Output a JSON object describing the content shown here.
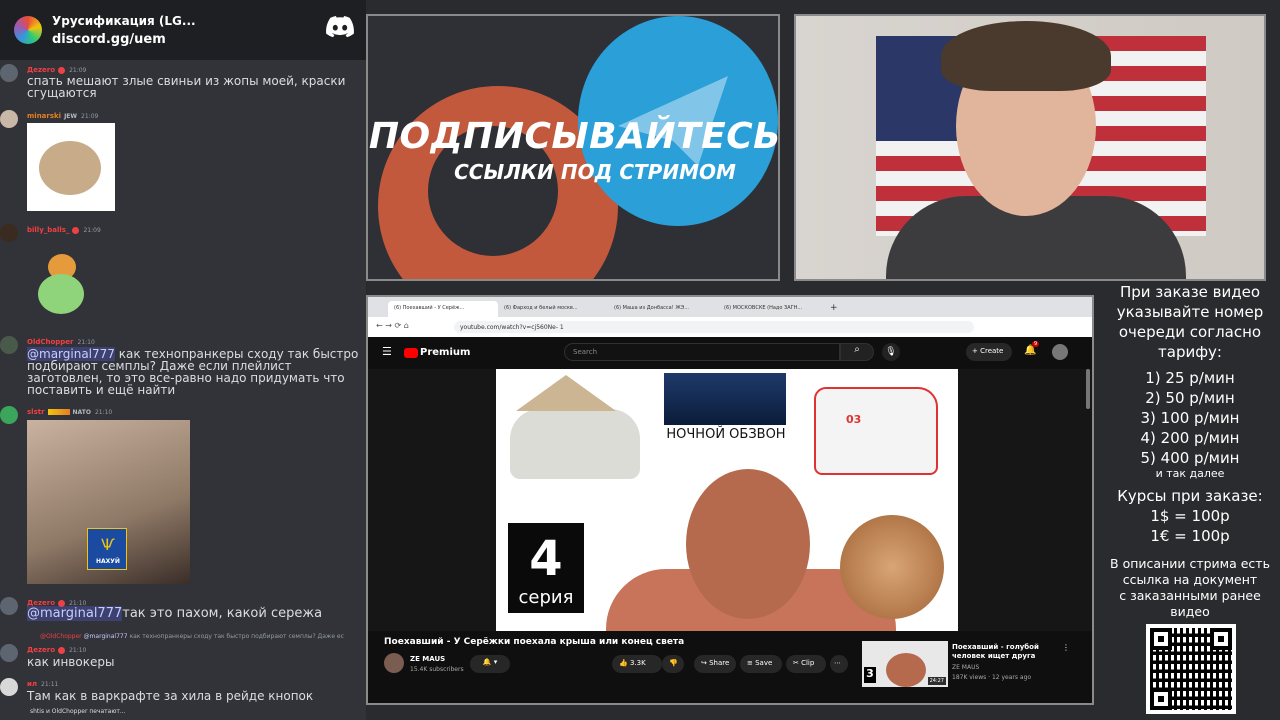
{
  "discord": {
    "server_name": "Урусификация (LG...",
    "invite": "discord.gg/uem",
    "messages": [
      {
        "user": "Дezero",
        "time": "21:09",
        "color": "#f23f43",
        "text": "спать мешают злые свиньи из жопы моей, краски сгущаются"
      },
      {
        "user": "minarski",
        "time": "21:09",
        "color": "#e67e22",
        "tag": "JEW",
        "text": ""
      },
      {
        "user": "billy_balls_",
        "time": "21:09",
        "color": "#f23f43",
        "text": ""
      },
      {
        "user": "OldChopper",
        "time": "21:10",
        "color": "#f23f43",
        "mention": "@marginal777",
        "text": " как технопранкеры сходу так быстро подбирают семплы? Даже если плейлист заготовлен, то это все-равно надо придумать что поставить и ещё найти"
      },
      {
        "user": "slstr",
        "time": "21:10",
        "color": "#f23f43",
        "tag": "NATO",
        "text": "",
        "stamp": "НАХУЙ"
      },
      {
        "user": "Дezero",
        "time": "21:10",
        "color": "#f23f43",
        "mention": "@marginal777",
        "text": "так это пахом, какой сережа"
      },
      {
        "reply_user": "@OldChopper",
        "reply_mention": "@marginal777",
        "reply_text": "как технопранкеры сходу так быстро подбирают семплы? Даже ес"
      },
      {
        "user": "Дezero",
        "time": "21:10",
        "color": "#f23f43",
        "text": "как инвокеры"
      },
      {
        "user": "ил",
        "time": "21:11",
        "color": "#f23f43",
        "text": "Там как в варкрафте за хила в рейде кнопок"
      }
    ],
    "typing_text": "shtis и OldChopper печатают..."
  },
  "promo": {
    "title": "ПОДПИСЫВАЙТЕСЬ",
    "subtitle": "ССЫЛКИ ПОД СТРИМОМ"
  },
  "browser": {
    "tabs": [
      "(6) Поехавший - У Серёж...",
      "(6) Фарход и белый москв...",
      "(6) Маша из Донбасса! ЖЭ...",
      "(6) МОСКОВСКЕ (Надо ЗАГН..."
    ],
    "url": "youtube.com/watch?v=cj560Ne- 1",
    "youtube": {
      "logo": "Premium",
      "search_placeholder": "Search",
      "create_label": "Create",
      "notif_count": "9",
      "video_title": "Поехавший - У Серёжки поехала крыша или конец света",
      "channel": "ZE MAUS",
      "subscribers": "15.4K subscribers",
      "likes": "3.3K",
      "share": "Share",
      "save": "Save",
      "clip": "Clip",
      "thumb_label": "НОЧНОЙ ОБЗВОН",
      "thumb_episode_num": "4",
      "thumb_episode_word": "серия",
      "thumb_ambulance": "03",
      "recommended": {
        "title": "Поехавший - голубой человек ищет друга",
        "channel": "ZE MAUS",
        "meta": "187K views · 12 years ago",
        "duration": "24:27",
        "thumb_num": "3"
      }
    }
  },
  "info": {
    "heading": [
      "При заказе видео",
      "указывайте номер",
      "очереди согласно",
      "тарифу:"
    ],
    "tariffs": [
      "1) 25 р/мин",
      "2) 50 р/мин",
      "3) 100 р/мин",
      "4) 200 р/мин",
      "5) 400 р/мин"
    ],
    "etc": "и так далее",
    "rates_title": "Курсы при заказе:",
    "rates": [
      "1$ = 100р",
      "1€ = 100р"
    ],
    "desc": [
      "В описании стрима есть",
      "ссылка на документ",
      "с заказанными ранее",
      "видео"
    ]
  }
}
